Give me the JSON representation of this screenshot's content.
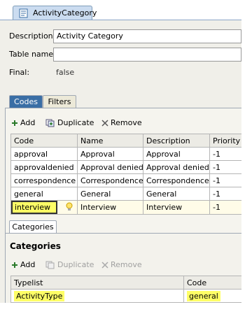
{
  "editor": {
    "tab_title": "ActivityCategory",
    "description_label": "Description:",
    "description_value": "Activity Category",
    "tablename_label": "Table name:",
    "tablename_value": "",
    "final_label": "Final:",
    "final_value": "false"
  },
  "tabs": [
    {
      "label": "Codes",
      "active": true
    },
    {
      "label": "Filters",
      "active": false
    }
  ],
  "codes_toolbar": {
    "add": "Add",
    "duplicate": "Duplicate",
    "remove": "Remove"
  },
  "codes_table": {
    "headers": [
      "Code",
      "Name",
      "Description",
      "Priority"
    ],
    "rows": [
      [
        "approval",
        "Approval",
        "Approval",
        "-1"
      ],
      [
        "approvaldenied",
        "Approval denied",
        "Approval denied",
        "-1"
      ],
      [
        "correspondence",
        "Correspondence",
        "Correspondence",
        "-1"
      ],
      [
        "general",
        "General",
        "General",
        "-1"
      ],
      [
        "interview",
        "Interview",
        "Interview",
        "-1"
      ]
    ]
  },
  "categories": {
    "tab_label": "Categories",
    "section_title": "Categories",
    "toolbar": {
      "add": "Add",
      "duplicate": "Duplicate",
      "remove": "Remove"
    },
    "headers": [
      "Typelist",
      "Code"
    ],
    "rows": [
      [
        "ActivityType",
        "general"
      ]
    ]
  },
  "colors": {
    "highlight": "#ffff66",
    "active_tab": "#3a6ea5"
  }
}
